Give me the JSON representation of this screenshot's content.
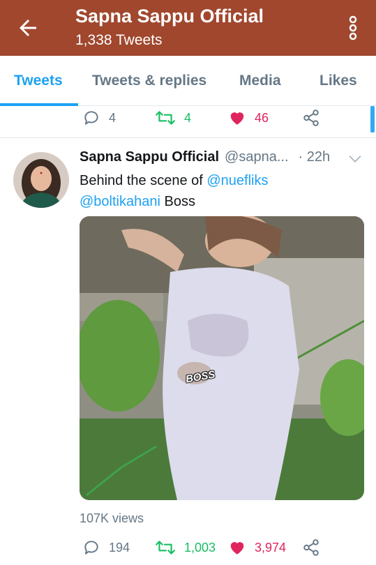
{
  "header": {
    "title": "Sapna Sappu Official",
    "subtitle": "1,338 Tweets"
  },
  "tabs": [
    {
      "label": "Tweets",
      "active": true
    },
    {
      "label": "Tweets & replies",
      "active": false
    },
    {
      "label": "Media",
      "active": false
    },
    {
      "label": "Likes",
      "active": false
    }
  ],
  "prev_tweet": {
    "replies": "4",
    "retweets": "4",
    "likes": "46"
  },
  "tweet": {
    "name": "Sapna Sappu Official",
    "handle": "@sapna...",
    "time": "· 22h",
    "text_line1": "Behind the scene of ",
    "mention1": "@nuefliks",
    "mention2": "@boltikahani",
    "text_tail": " Boss",
    "media_caption": "BOSS",
    "views": "107K views",
    "replies": "194",
    "retweets": "1,003",
    "likes": "3,974"
  },
  "colors": {
    "header_bg": "#a0472e",
    "accent": "#1da1f2",
    "retweet": "#17bf63",
    "like": "#e0245e",
    "muted": "#657786"
  }
}
